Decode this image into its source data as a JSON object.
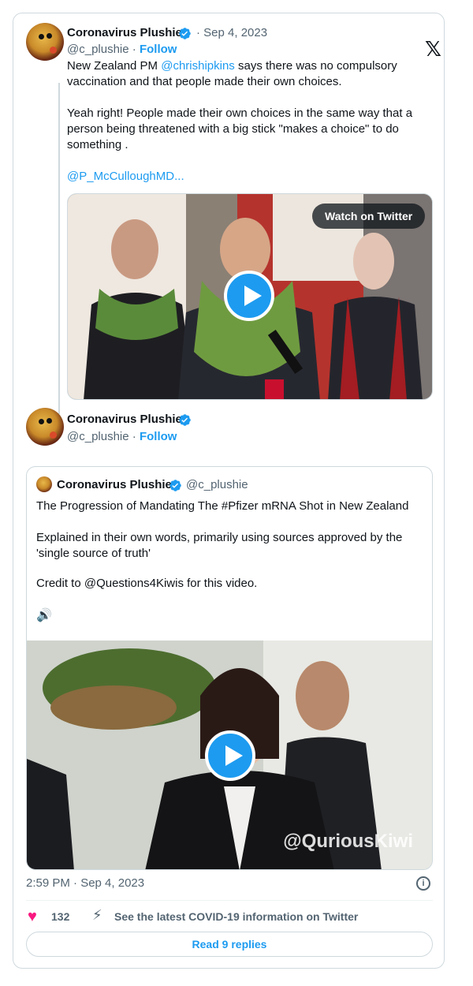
{
  "tweet1": {
    "display_name": "Coronavirus Plushie",
    "date": "· Sep 4, 2023",
    "handle": "@c_plushie ·",
    "follow_label": "Follow",
    "text_prefix": "New Zealand PM ",
    "mention": "@chrishipkins",
    "text_suffix": " says there was no compulsory vaccination and that people made their own choices.",
    "paragraph2": "Yeah right! People made their own choices in the same way that a person being threatened with a big stick \"makes a choice\" to do something .",
    "truncated_link": "@P_McCulloughMD...",
    "media": {
      "watch_label": "Watch on Twitter"
    }
  },
  "tweet2": {
    "display_name": "Coronavirus Plushie",
    "handle": "@c_plushie ·",
    "follow_label": "Follow"
  },
  "quote": {
    "display_name": "Coronavirus Plushie",
    "handle": "@c_plushie",
    "line1": "The Progression of Mandating The #Pfizer mRNA Shot in New Zealand",
    "line2": "Explained in their own words, primarily using sources approved by the 'single source of truth'",
    "line3": "Credit to @Questions4Kiwis for this video.",
    "media": {
      "watermark": "@QuriousKiwi"
    }
  },
  "footer": {
    "timestamp": "2:59 PM · Sep 4, 2023",
    "like_count": "132",
    "covid_info": "See the latest COVID-19 information on Twitter",
    "read_replies": "Read 9 replies"
  },
  "icons": {
    "x_logo": "x-logo-icon",
    "verified": "verified-badge-icon",
    "play": "play-icon",
    "heart": "heart-icon",
    "info": "info-icon",
    "speaker": "speaker-icon",
    "lightning": "lightning-icon"
  },
  "colors": {
    "accent": "#1d9bf0",
    "heart": "#f91880",
    "text": "#0f1419",
    "muted": "#536471",
    "border": "#cfd9de"
  }
}
